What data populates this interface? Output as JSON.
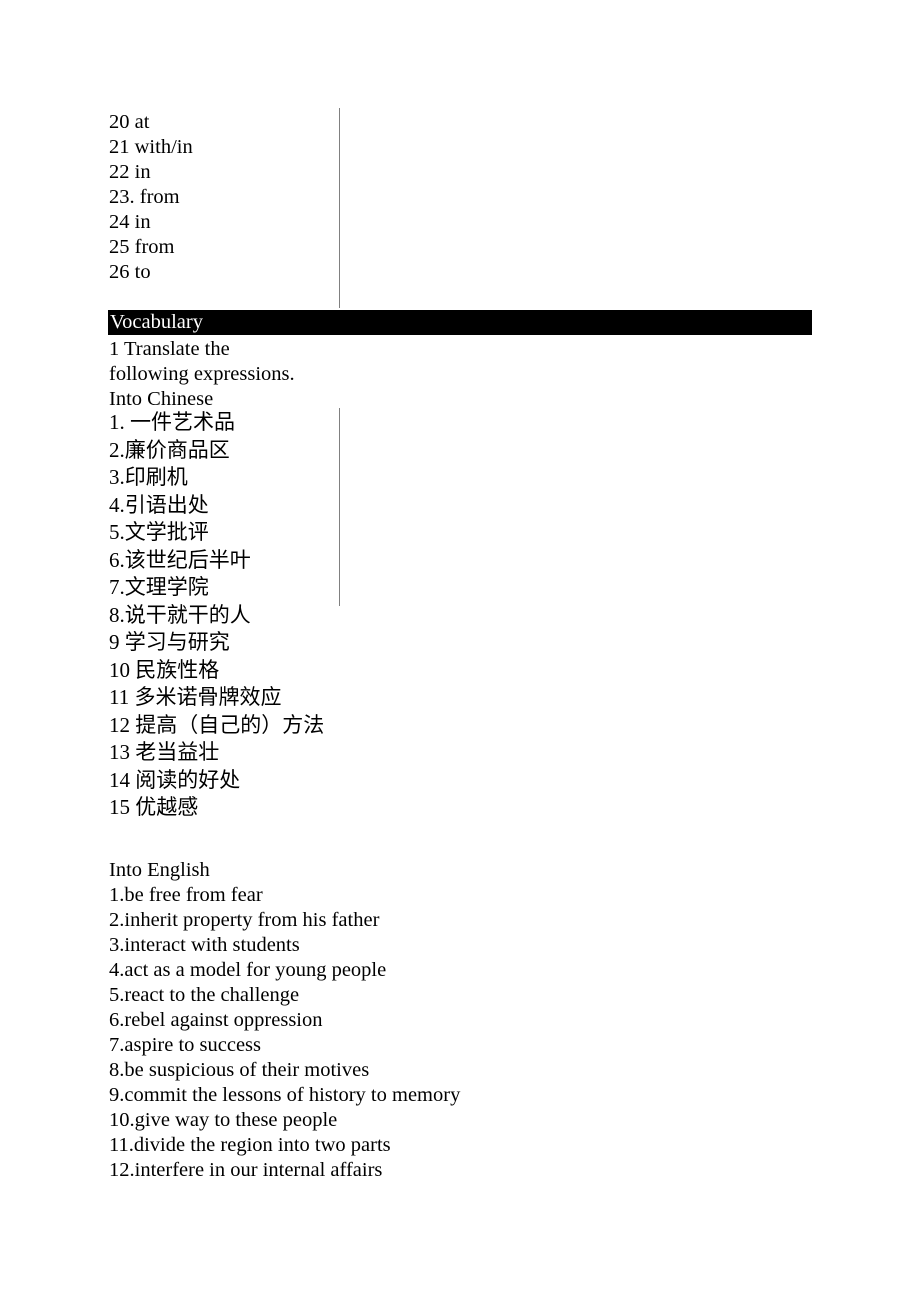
{
  "document": {
    "answers_section": {
      "lines": [
        "20 at",
        "21 with/in",
        "22 in",
        "23. from",
        "24 in",
        "25 from",
        "26 to"
      ]
    },
    "vocabulary_section": {
      "banner_title": "Vocabulary",
      "banner_bg_color": "#000000",
      "banner_text_color": "#ffffff",
      "instruction_lines": [
        "1 Translate the",
        "following expressions.",
        "Into Chinese"
      ],
      "into_chinese": [
        "1. 一件艺术品",
        "2.廉价商品区",
        "3.印刷机",
        "4.引语出处",
        "5.文学批评",
        "6.该世纪后半叶",
        "7.文理学院",
        "8.说干就干的人",
        "9 学习与研究",
        "10 民族性格",
        "11 多米诺骨牌效应",
        "12 提高（自己的）方法",
        "13 老当益壮",
        "14 阅读的好处",
        "15 优越感"
      ],
      "into_english_heading": "Into English",
      "into_english": [
        "1.be free from fear",
        "2.inherit property from his father",
        "3.interact with students",
        "4.act as a model for young people",
        "5.react to the challenge",
        "6.rebel against oppression",
        "7.aspire to success",
        "8.be suspicious of their motives",
        "9.commit the lessons of history to memory",
        "10.give way to these people",
        "11.divide the region into two parts",
        "12.interfere in our internal affairs"
      ]
    }
  }
}
